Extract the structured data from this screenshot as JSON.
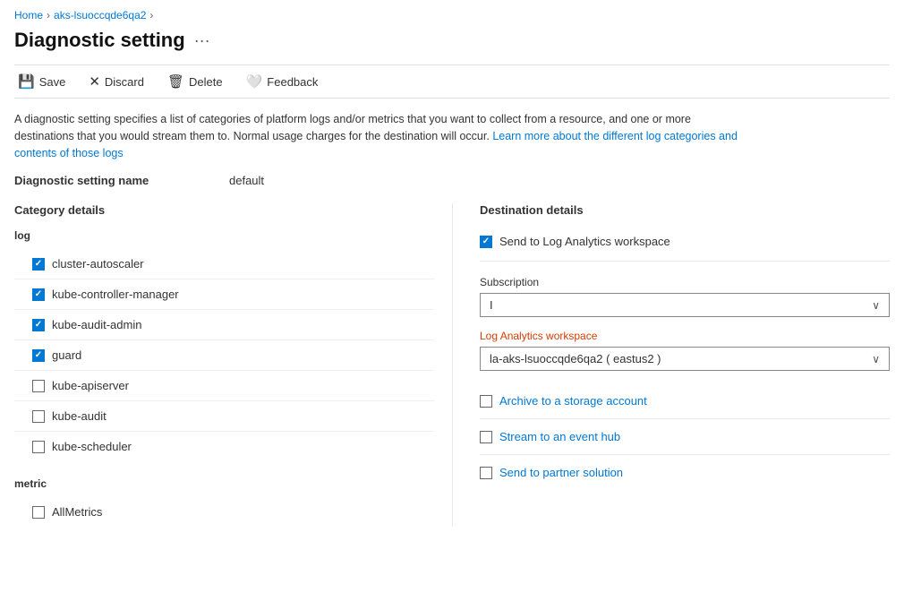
{
  "breadcrumb": {
    "items": [
      "Home",
      "aks-lsuoccqde6qa2"
    ]
  },
  "page": {
    "title": "Diagnostic setting",
    "more_icon": "···"
  },
  "toolbar": {
    "save": "Save",
    "discard": "Discard",
    "delete": "Delete",
    "feedback": "Feedback"
  },
  "description": {
    "main_text": "A diagnostic setting specifies a list of categories of platform logs and/or metrics that you want to collect from a resource, and one or more destinations that you would stream them to. Normal usage charges for the destination will occur.",
    "link_text": "Learn more about the different log categories and contents of those logs"
  },
  "setting_name": {
    "label": "Diagnostic setting name",
    "value": "default"
  },
  "category_details": {
    "title": "Category details",
    "log_group_title": "log",
    "log_items": [
      {
        "id": "cluster-autoscaler",
        "label": "cluster-autoscaler",
        "checked": true
      },
      {
        "id": "kube-controller-manager",
        "label": "kube-controller-manager",
        "checked": true
      },
      {
        "id": "kube-audit-admin",
        "label": "kube-audit-admin",
        "checked": true
      },
      {
        "id": "guard",
        "label": "guard",
        "checked": true
      },
      {
        "id": "kube-apiserver",
        "label": "kube-apiserver",
        "checked": false
      },
      {
        "id": "kube-audit",
        "label": "kube-audit",
        "checked": false
      },
      {
        "id": "kube-scheduler",
        "label": "kube-scheduler",
        "checked": false
      }
    ],
    "metric_group_title": "metric",
    "metric_items": [
      {
        "id": "AllMetrics",
        "label": "AllMetrics",
        "checked": false
      }
    ]
  },
  "destination_details": {
    "title": "Destination details",
    "send_to_log_analytics": {
      "label": "Send to Log Analytics workspace",
      "checked": true
    },
    "subscription": {
      "label": "Subscription",
      "value": "I"
    },
    "log_analytics_workspace": {
      "label": "Log Analytics workspace",
      "is_required": true,
      "value": "la-aks-lsuoccqde6qa2 ( eastus2 )"
    },
    "archive_storage": {
      "label": "Archive to a storage account",
      "checked": false
    },
    "stream_event_hub": {
      "label": "Stream to an event hub",
      "checked": false
    },
    "send_partner": {
      "label": "Send to partner solution",
      "checked": false
    }
  }
}
